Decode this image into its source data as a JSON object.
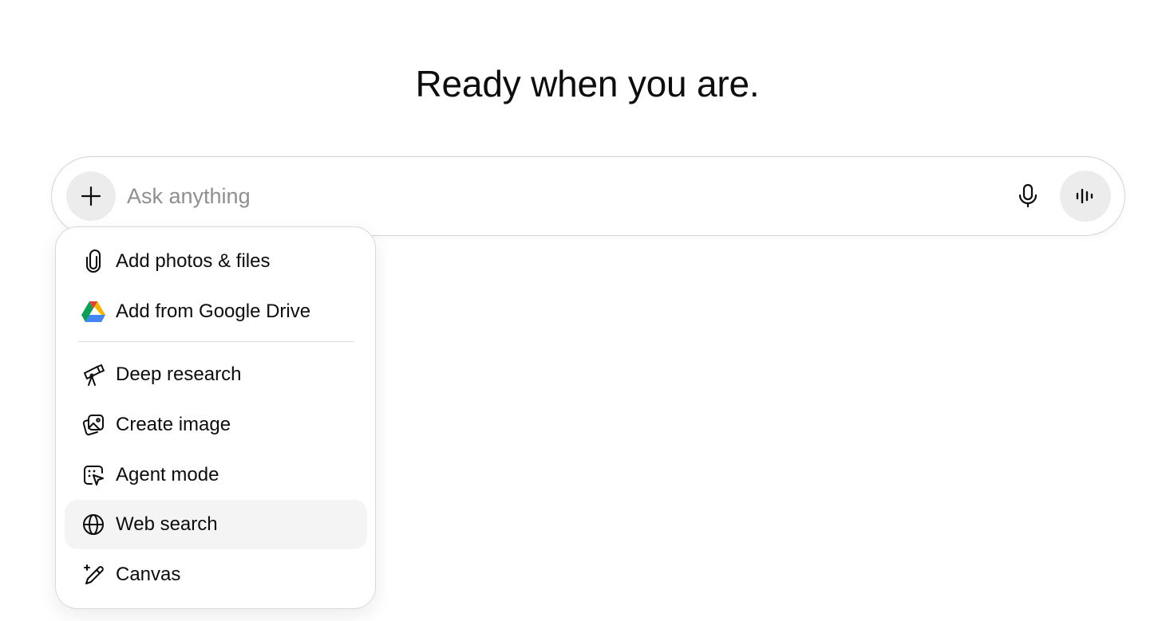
{
  "headline": "Ready when you are.",
  "composer": {
    "placeholder": "Ask anything",
    "value": "",
    "plus_icon": "plus-icon",
    "mic_icon": "microphone-icon",
    "voice_icon": "voice-waveform-icon"
  },
  "menu": {
    "group1": [
      {
        "label": "Add photos & files",
        "icon": "paperclip-icon"
      },
      {
        "label": "Add from Google Drive",
        "icon": "google-drive-icon"
      }
    ],
    "group2": [
      {
        "label": "Deep research",
        "icon": "telescope-icon"
      },
      {
        "label": "Create image",
        "icon": "image-icon"
      },
      {
        "label": "Agent mode",
        "icon": "agent-cursor-icon"
      },
      {
        "label": "Web search",
        "icon": "globe-icon",
        "active": true
      },
      {
        "label": "Canvas",
        "icon": "pencil-sparkle-icon"
      }
    ]
  },
  "colors": {
    "text": "#0d0d0d",
    "placeholder": "#8f8f8f",
    "button_bg": "#ececec",
    "active_item_bg": "#f4f4f4",
    "drive_blue": "#4285F4",
    "drive_green": "#0F9D58",
    "drive_yellow": "#F4B400",
    "drive_red": "#DB4437"
  }
}
